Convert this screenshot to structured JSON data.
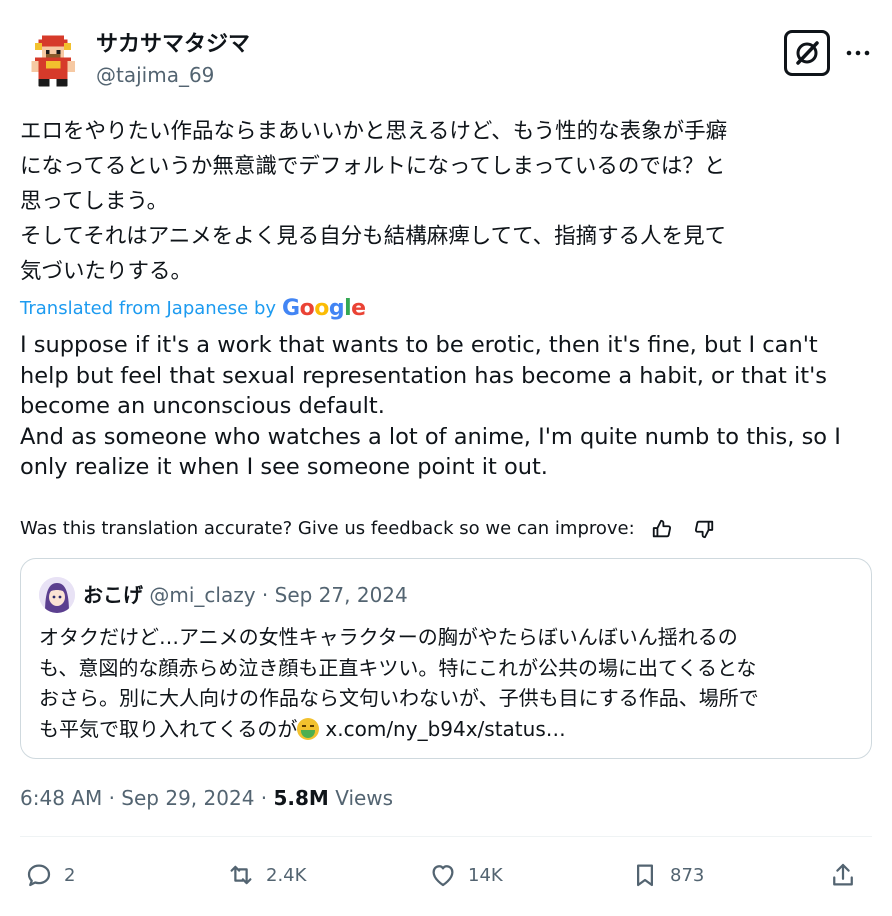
{
  "author": {
    "name": "サカサマタジマ",
    "handle": "@tajima_69",
    "avatar_icon": "pixel-robot-avatar-icon"
  },
  "header_icons": {
    "grok": "grok-icon",
    "more": "more-options-icon"
  },
  "tweet": {
    "text_lines": [
      "エロをやりたい作品ならまあいいかと思えるけど、もう性的な表象が手癖",
      "になってるというか無意識でデフォルトになってしまっているのでは？と",
      "思ってしまう。",
      "そしてそれはアニメをよく見る自分も結構麻痺してて、指摘する人を見て",
      "気づいたりする。"
    ],
    "translated_label": "Translated from Japanese by",
    "google_letters": [
      "G",
      "o",
      "o",
      "g",
      "l",
      "e"
    ],
    "translation_lines": [
      "I suppose if it's a work that wants to be erotic, then it's fine, but I can't",
      "help but feel that sexual representation has become a habit, or that it's",
      "become an unconscious default.",
      "And as someone who watches a lot of anime, I'm quite numb to this, so I",
      "only realize it when I see someone point it out."
    ],
    "feedback_text": "Was this translation accurate? Give us feedback so we can improve:"
  },
  "quote": {
    "name": "おこげ",
    "handle": "@mi_clazy",
    "separator": "·",
    "date": "Sep 27, 2024",
    "text_lines": [
      "オタクだけど…アニメの女性キャラクターの胸がやたらぼいんぼいん揺れるの",
      "も、意図的な顔赤らめ泣き顔も正直キツい。特にこれが公共の場に出てくるとな",
      "おさら。別に大人向けの作品なら文句いわないが、子供も目にする作品、場所で",
      "も平気で取り入れてくるのが"
    ],
    "link_text": "x.com/ny_b94x/status…",
    "emoji_icon": "nauseated-face-icon"
  },
  "meta": {
    "time": "6:48 AM",
    "sep1": "·",
    "date": "Sep 29, 2024",
    "sep2": "·",
    "views_count": "5.8M",
    "views_label": "Views"
  },
  "actions": {
    "replies": "2",
    "reposts": "2.4K",
    "likes": "14K",
    "bookmarks": "873"
  },
  "colors": {
    "text": "#0f1419",
    "secondary": "#536471",
    "link": "#1d9bf0",
    "border": "#cfd9de"
  }
}
